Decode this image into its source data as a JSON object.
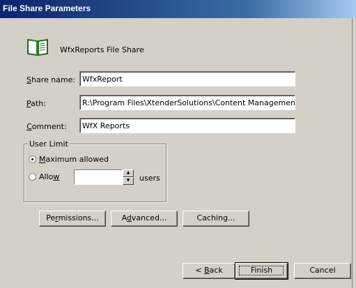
{
  "window": {
    "title": "File Share Parameters"
  },
  "share": {
    "heading": "WfxReports File Share",
    "icon": "book-icon"
  },
  "fields": {
    "share_name": {
      "label_pre": "",
      "label_u": "S",
      "label_post": "hare name:",
      "value": "WfxReport"
    },
    "path": {
      "label_pre": "",
      "label_u": "P",
      "label_post": "ath:",
      "value": "R:\\Program Files\\XtenderSolutions\\Content Management\\"
    },
    "comment": {
      "label_pre": "",
      "label_u": "C",
      "label_post": "omment:",
      "value": "WfX Reports"
    }
  },
  "user_limit": {
    "title": "User Limit",
    "max_pre": "",
    "max_u": "M",
    "max_post": "aximum allowed",
    "allow_pre": "Allo",
    "allow_u": "w",
    "allow_post": "",
    "allow_value": "",
    "users_label": "users",
    "selected": "maximum"
  },
  "buttons": {
    "permissions": {
      "pre": "Pe",
      "u": "r",
      "post": "missions..."
    },
    "advanced": {
      "pre": "A",
      "u": "d",
      "post": "vanced..."
    },
    "caching": {
      "pre": "Caching...",
      "u": "",
      "post": ""
    },
    "back": {
      "pre": "< ",
      "u": "B",
      "post": "ack"
    },
    "finish": {
      "pre": "Finish",
      "u": "",
      "post": ""
    },
    "cancel": {
      "pre": "Cancel",
      "u": "",
      "post": ""
    }
  },
  "colors": {
    "title_bar": "#0a246a",
    "dialog_bg": "#d4d0c8"
  }
}
